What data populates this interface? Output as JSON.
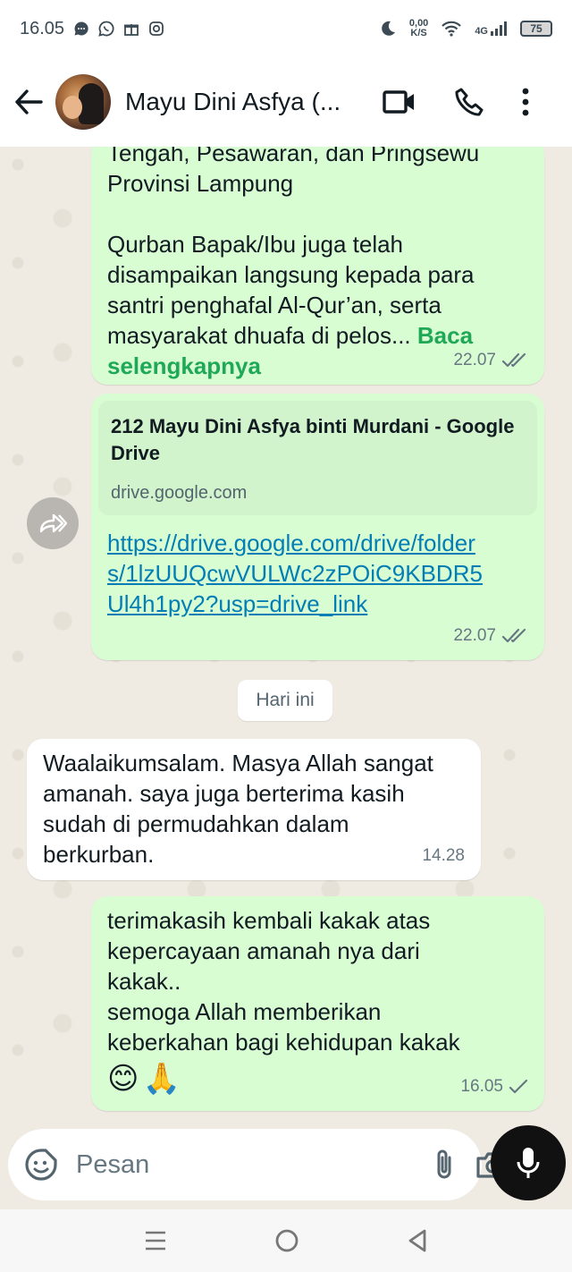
{
  "status_bar": {
    "time": "16.05",
    "net_rate_value": "0,00",
    "net_rate_unit": "K/S",
    "network": "4G",
    "battery": "75"
  },
  "header": {
    "contact_name": "Mayu Dini Asfya (..."
  },
  "messages": [
    {
      "direction": "outgoing",
      "text_lines": [
        "Tengah, Pesawaran, dan Pringsewu",
        "Provinsi Lampung",
        "",
        "Qurban Bapak/Ibu juga telah",
        "disampaikan langsung kepada para",
        "santri penghafal Al-Qur’an, serta",
        "masyarakat dhuafa di pelos..."
      ],
      "read_more": "Baca selengkapnya",
      "time": "22.07",
      "status": "read"
    },
    {
      "direction": "outgoing",
      "link_preview_title": "212 Mayu Dini Asfya binti Murdani - Google Drive",
      "link_preview_domain": "drive.google.com",
      "url": "https://drive.google.com/drive/folders/1lzUUQcwVULWc2zPOiC9KBDR5Ul4h1py2?usp=drive_link",
      "time": "22.07",
      "status": "read"
    },
    {
      "direction": "incoming",
      "text": "Waalaikumsalam. Masya Allah sangat amanah. saya juga berterima kasih sudah di permudahkan dalam berkurban.",
      "time": "14.28"
    },
    {
      "direction": "outgoing",
      "text_lines": [
        "terimakasih kembali kakak atas",
        "kepercayaan amanah nya dari",
        "kakak..",
        "semoga Allah memberikan",
        "keberkahan bagi kehidupan kakak"
      ],
      "emojis": [
        "😊",
        "🙏"
      ],
      "time": "16.05",
      "status": "sent"
    }
  ],
  "date_divider": "Hari ini",
  "composer": {
    "placeholder": "Pesan"
  },
  "colors": {
    "outgoing_bubble": "#d9fdd3",
    "incoming_bubble": "#ffffff",
    "link": "#027eb5",
    "read_more": "#1fa855",
    "chat_background": "#efeae2"
  }
}
